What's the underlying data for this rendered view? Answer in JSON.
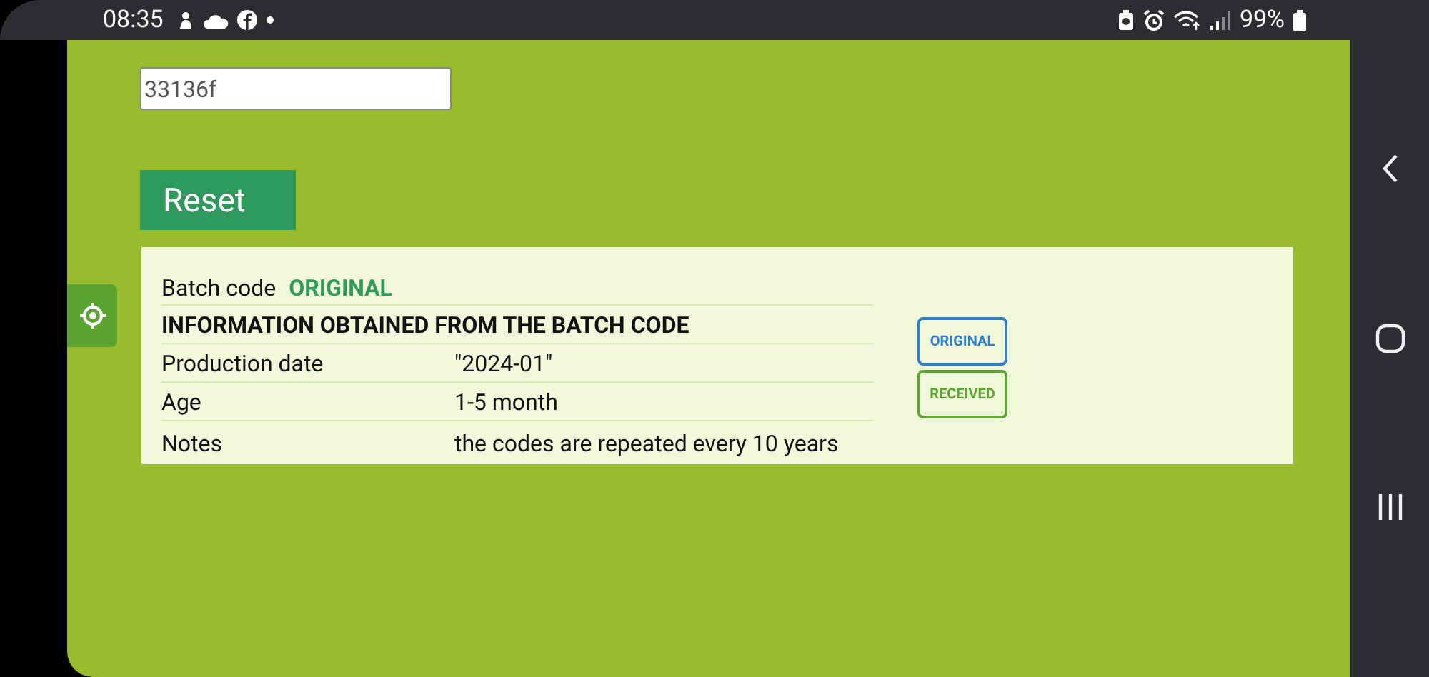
{
  "status_bar": {
    "time": "08:35",
    "battery": "99%"
  },
  "code_field": {
    "value": "33136f"
  },
  "reset_button": {
    "label": "Reset"
  },
  "result": {
    "batch_label": "Batch code",
    "batch_status": "ORIGINAL",
    "heading": "INFORMATION OBTAINED FROM THE BATCH CODE",
    "rows": [
      {
        "label": "Production date",
        "value": "\"2024-01\""
      },
      {
        "label": "Age",
        "value": "1-5 month"
      },
      {
        "label": "Notes",
        "value": "the codes are repeated every 10 years"
      }
    ],
    "badges": [
      {
        "text": "ORIGINAL",
        "kind": "original"
      },
      {
        "text": "RECEIVED",
        "kind": "received"
      }
    ]
  }
}
